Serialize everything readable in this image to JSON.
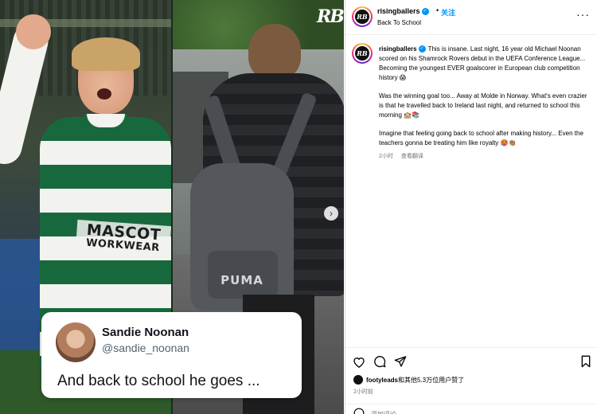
{
  "media": {
    "watermark": "RB",
    "tweet": {
      "name": "Sandie Noonan",
      "handle": "@sandie_noonan",
      "text": "And back to school he goes ..."
    },
    "sponsor_line1": "MASCOT",
    "sponsor_line2": "WORKWEAR",
    "backpack_brand": "PUMA"
  },
  "header": {
    "avatar_text": "RB",
    "username": "risingballers",
    "dot": "•",
    "follow_label": "关注",
    "subtitle": "Back To School",
    "more": "···"
  },
  "caption": {
    "username": "risingballers",
    "paragraphs": [
      "This is insane. Last night, 16 year old Michael Noonan scored on his Shamrock Rovers debut in the UEFA Conference League... Becoming the youngest EVER goalscorer in European club competition history 😱",
      "Was the winning goal too... Away at Molde in Norway. What's even crazier is that he travelled back to Ireland last night, and returned to school this morning 🏫📚",
      "Imagine that feeling going back to school after making history... Even the teachers gonna be treating him like royalty 🥵👏🏽"
    ],
    "time": "2小时",
    "translate": "查看翻译"
  },
  "actions": {
    "like_icon": "heart-icon",
    "comment_icon": "comment-icon",
    "share_icon": "send-icon",
    "save_icon": "bookmark-icon",
    "likes_user": "footyleads",
    "likes_rest": "和其他5.3万位用户赞了",
    "posted": "2小时前",
    "comment_placeholder": "添加评论..."
  },
  "colors": {
    "accent": "#0095f6",
    "muted": "#737373",
    "border": "#dbdbdb"
  }
}
